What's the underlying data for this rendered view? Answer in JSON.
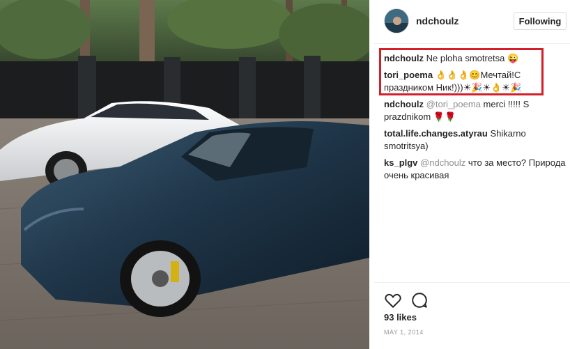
{
  "post": {
    "author": "ndchoulz",
    "follow_label": "Following",
    "likes": "93 likes",
    "date": "MAY 1, 2014"
  },
  "comments": [
    {
      "user": "ndchoulz",
      "text": "Ne ploha smotretsa 😜"
    },
    {
      "user": "tori_poema",
      "text": "👌👌👌😊Мечтай!С праздником Ник!)))☀🎉☀👌☀🎉"
    },
    {
      "user": "ndchoulz",
      "mention": "@tori_poema",
      "text": "merci !!!!! S prazdnikom 🌹🌹"
    },
    {
      "user": "total.life.changes.atyrau",
      "text": "Shikarno smotritsya)"
    },
    {
      "user": "ks_plgv",
      "mention": "@ndchoulz",
      "text": "что за место? Природа очень красивая"
    }
  ],
  "icons": {
    "like": "heart-icon",
    "comment": "comment-icon"
  },
  "colors": {
    "highlight": "#d31f2a",
    "border": "#dbdbdb",
    "muted": "#8e8e8e"
  }
}
